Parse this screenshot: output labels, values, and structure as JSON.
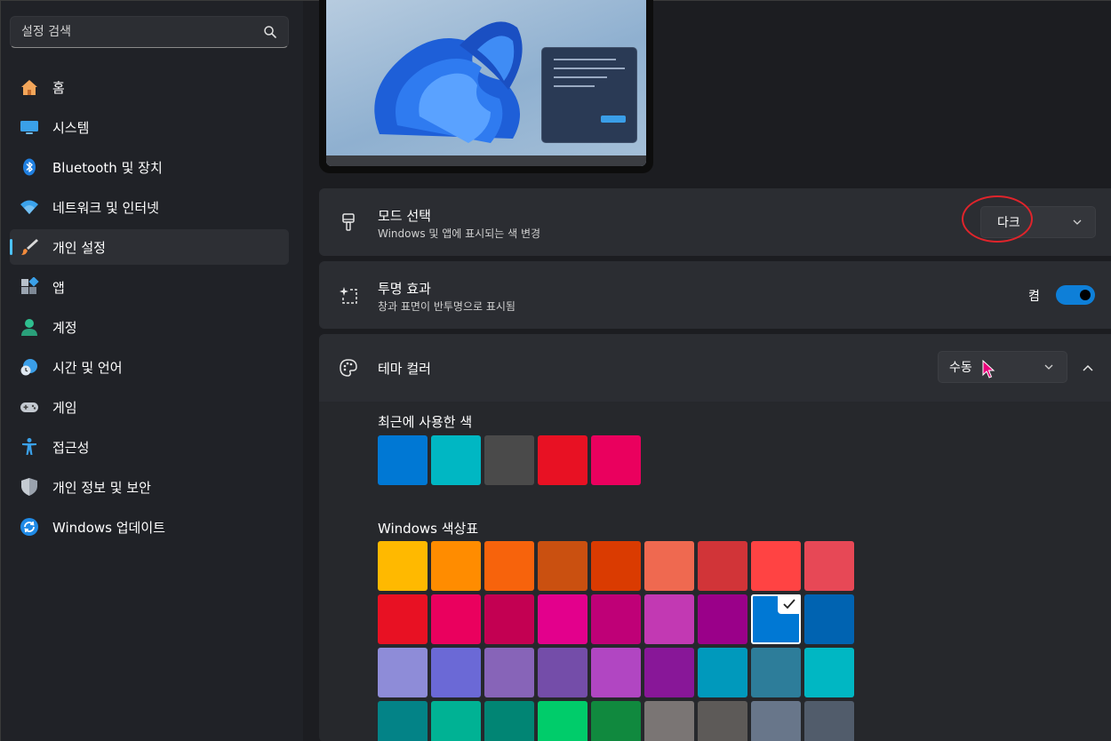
{
  "search": {
    "placeholder": "설정 검색",
    "icon": "search-icon"
  },
  "sidebar": {
    "items": [
      {
        "label": "홈",
        "icon": "home-icon",
        "active": false
      },
      {
        "label": "시스템",
        "icon": "monitor-icon",
        "active": false
      },
      {
        "label": "Bluetooth 및 장치",
        "icon": "bluetooth-icon",
        "active": false
      },
      {
        "label": "네트워크 및 인터넷",
        "icon": "wifi-icon",
        "active": false
      },
      {
        "label": "개인 설정",
        "icon": "brush-icon",
        "active": true
      },
      {
        "label": "앱",
        "icon": "apps-icon",
        "active": false
      },
      {
        "label": "계정",
        "icon": "person-icon",
        "active": false
      },
      {
        "label": "시간 및 언어",
        "icon": "clock-globe-icon",
        "active": false
      },
      {
        "label": "게임",
        "icon": "gamepad-icon",
        "active": false
      },
      {
        "label": "접근성",
        "icon": "accessibility-icon",
        "active": false
      },
      {
        "label": "개인 정보 및 보안",
        "icon": "shield-icon",
        "active": false
      },
      {
        "label": "Windows 업데이트",
        "icon": "update-icon",
        "active": false
      }
    ]
  },
  "mode": {
    "title": "모드 선택",
    "subtitle": "Windows 및 앱에 표시되는 색 변경",
    "value": "다크",
    "icon": "paintbrush-icon"
  },
  "transparency": {
    "title": "투명 효과",
    "subtitle": "창과 표면이 반투명으로 표시됨",
    "state_label": "켬",
    "on": true,
    "icon": "sparkle-icon"
  },
  "theme_color": {
    "title": "테마 컬러",
    "value": "수동",
    "icon": "palette-icon",
    "expanded": true
  },
  "recent_colors": {
    "label": "최근에 사용한 색",
    "colors": [
      "#0078d4",
      "#00b7c3",
      "#4a4a4a",
      "#e81123",
      "#ea005e"
    ]
  },
  "windows_palette": {
    "label": "Windows 색상표",
    "rows": [
      [
        "#ffb900",
        "#ff8c00",
        "#f7630c",
        "#ca5010",
        "#da3b01",
        "#ef6950",
        "#d13438",
        "#ff4343",
        "#e74856"
      ],
      [
        "#e81123",
        "#ea005e",
        "#c30052",
        "#e3008c",
        "#bf0077",
        "#c239b3",
        "#9a0089",
        "#0078d4",
        "#0063b1"
      ],
      [
        "#8e8cd8",
        "#6b69d6",
        "#8764b8",
        "#744da9",
        "#b146c2",
        "#881798",
        "#0099bc",
        "#2d7d9a",
        "#00b7c3"
      ],
      [
        "#038387",
        "#00b294",
        "#018574",
        "#00cc6a",
        "#10893e",
        "#7a7574",
        "#5d5a58",
        "#68768a",
        "#515c6b"
      ]
    ],
    "selected": "#0078d4"
  },
  "accent_color": "#4cc2ff",
  "annotation_color": "#e0242b"
}
